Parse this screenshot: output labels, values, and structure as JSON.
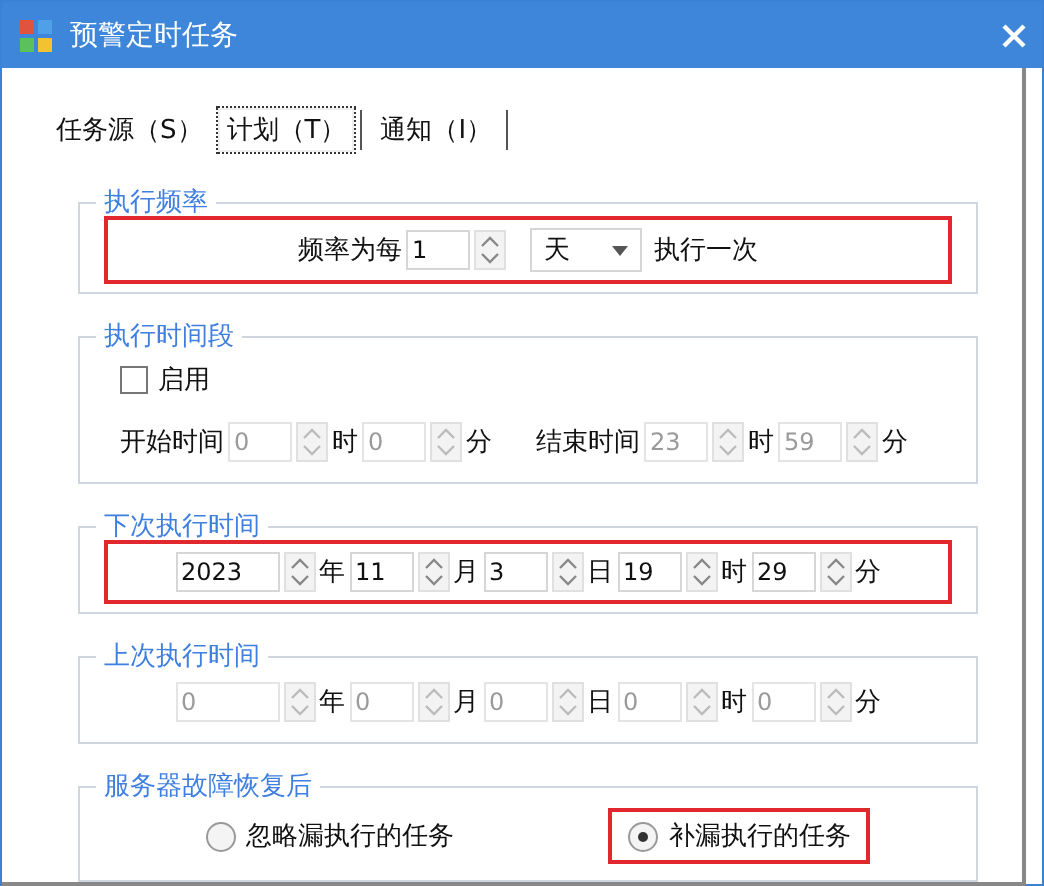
{
  "window": {
    "title": "预警定时任务"
  },
  "tabs": [
    {
      "label": "任务源（S）",
      "selected": false
    },
    {
      "label": "计划（T）",
      "selected": true
    },
    {
      "label": "通知（I）",
      "selected": false
    }
  ],
  "groups": [
    {
      "title": "执行频率",
      "rows": [
        {
          "highlighted": true,
          "items": [
            {
              "kind": "label",
              "text": "频率为每"
            },
            {
              "kind": "spinner",
              "value": "1",
              "disabled": false
            },
            {
              "kind": "dropdown",
              "value": "天"
            },
            {
              "kind": "label",
              "text": "执行一次"
            }
          ]
        }
      ]
    },
    {
      "title": "执行时间段",
      "rows": [
        {
          "highlighted": false,
          "items": [
            {
              "kind": "checkbox",
              "label": "启用",
              "checked": false
            }
          ]
        },
        {
          "highlighted": false,
          "items": [
            {
              "kind": "label",
              "text": "开始时间"
            },
            {
              "kind": "spinner",
              "value": "0",
              "disabled": true
            },
            {
              "kind": "label",
              "text": "时"
            },
            {
              "kind": "spinner",
              "value": "0",
              "disabled": true
            },
            {
              "kind": "label",
              "text": "分"
            },
            {
              "kind": "gap"
            },
            {
              "kind": "label",
              "text": "结束时间"
            },
            {
              "kind": "spinner",
              "value": "23",
              "disabled": true
            },
            {
              "kind": "label",
              "text": "时"
            },
            {
              "kind": "spinner",
              "value": "59",
              "disabled": true
            },
            {
              "kind": "label",
              "text": "分"
            }
          ]
        }
      ]
    },
    {
      "title": "下次执行时间",
      "rows": [
        {
          "highlighted": true,
          "items": [
            {
              "kind": "spinner",
              "value": "2023",
              "disabled": false
            },
            {
              "kind": "label",
              "text": "年"
            },
            {
              "kind": "spinner",
              "value": "11",
              "disabled": false
            },
            {
              "kind": "label",
              "text": "月"
            },
            {
              "kind": "spinner",
              "value": "3",
              "disabled": false
            },
            {
              "kind": "label",
              "text": "日"
            },
            {
              "kind": "spinner",
              "value": "19",
              "disabled": false
            },
            {
              "kind": "label",
              "text": "时"
            },
            {
              "kind": "spinner",
              "value": "29",
              "disabled": false
            },
            {
              "kind": "label",
              "text": "分"
            }
          ]
        }
      ]
    },
    {
      "title": "上次执行时间",
      "rows": [
        {
          "highlighted": false,
          "items": [
            {
              "kind": "spinner",
              "value": "0",
              "disabled": true
            },
            {
              "kind": "label",
              "text": "年"
            },
            {
              "kind": "spinner",
              "value": "0",
              "disabled": true
            },
            {
              "kind": "label",
              "text": "月"
            },
            {
              "kind": "spinner",
              "value": "0",
              "disabled": true
            },
            {
              "kind": "label",
              "text": "日"
            },
            {
              "kind": "spinner",
              "value": "0",
              "disabled": true
            },
            {
              "kind": "label",
              "text": "时"
            },
            {
              "kind": "spinner",
              "value": "0",
              "disabled": true
            },
            {
              "kind": "label",
              "text": "分"
            }
          ]
        }
      ]
    },
    {
      "title": "服务器故障恢复后",
      "rows": [
        {
          "highlighted": false,
          "items": [
            {
              "kind": "radio",
              "label": "忽略漏执行的任务",
              "selected": false,
              "highlighted": false
            },
            {
              "kind": "radio",
              "label": "补漏执行的任务",
              "selected": true,
              "highlighted": true
            }
          ]
        }
      ]
    }
  ]
}
